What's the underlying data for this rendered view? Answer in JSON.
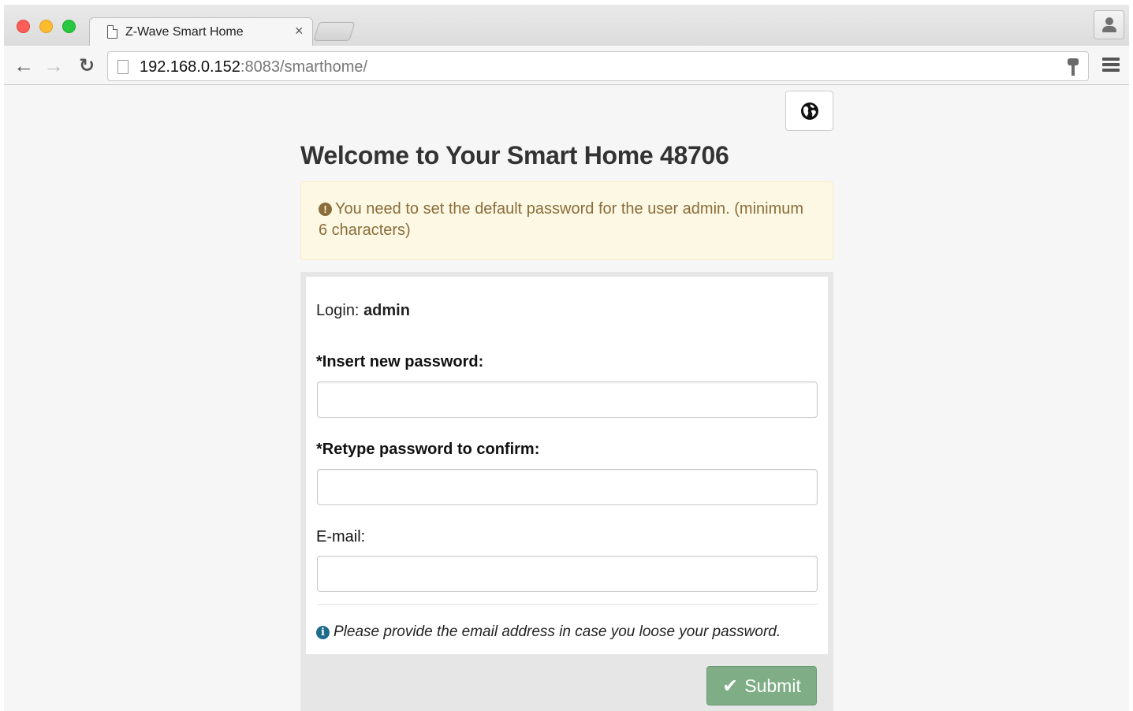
{
  "browser": {
    "tab_title": "Z-Wave Smart Home",
    "tab_close": "×",
    "url_host": "192.168.0.152",
    "url_rest": ":8083/smarthome/",
    "back": "←",
    "forward": "→",
    "reload": "↻"
  },
  "page": {
    "title": "Welcome to Your Smart Home 48706",
    "alert": {
      "icon": "!",
      "text": "You need to set the default password for the user admin. (minimum 6 characters)"
    },
    "form": {
      "login_label": "Login:",
      "login_value": "admin",
      "new_password_label": "*Insert new password:",
      "new_password_value": "",
      "confirm_password_label": "*Retype password to confirm:",
      "confirm_password_value": "",
      "email_label": "E-mail:",
      "email_value": "",
      "help_icon": "i",
      "help_text": "Please provide the email address in case you loose your password."
    },
    "submit_label": "Submit",
    "submit_icon": "✔"
  }
}
